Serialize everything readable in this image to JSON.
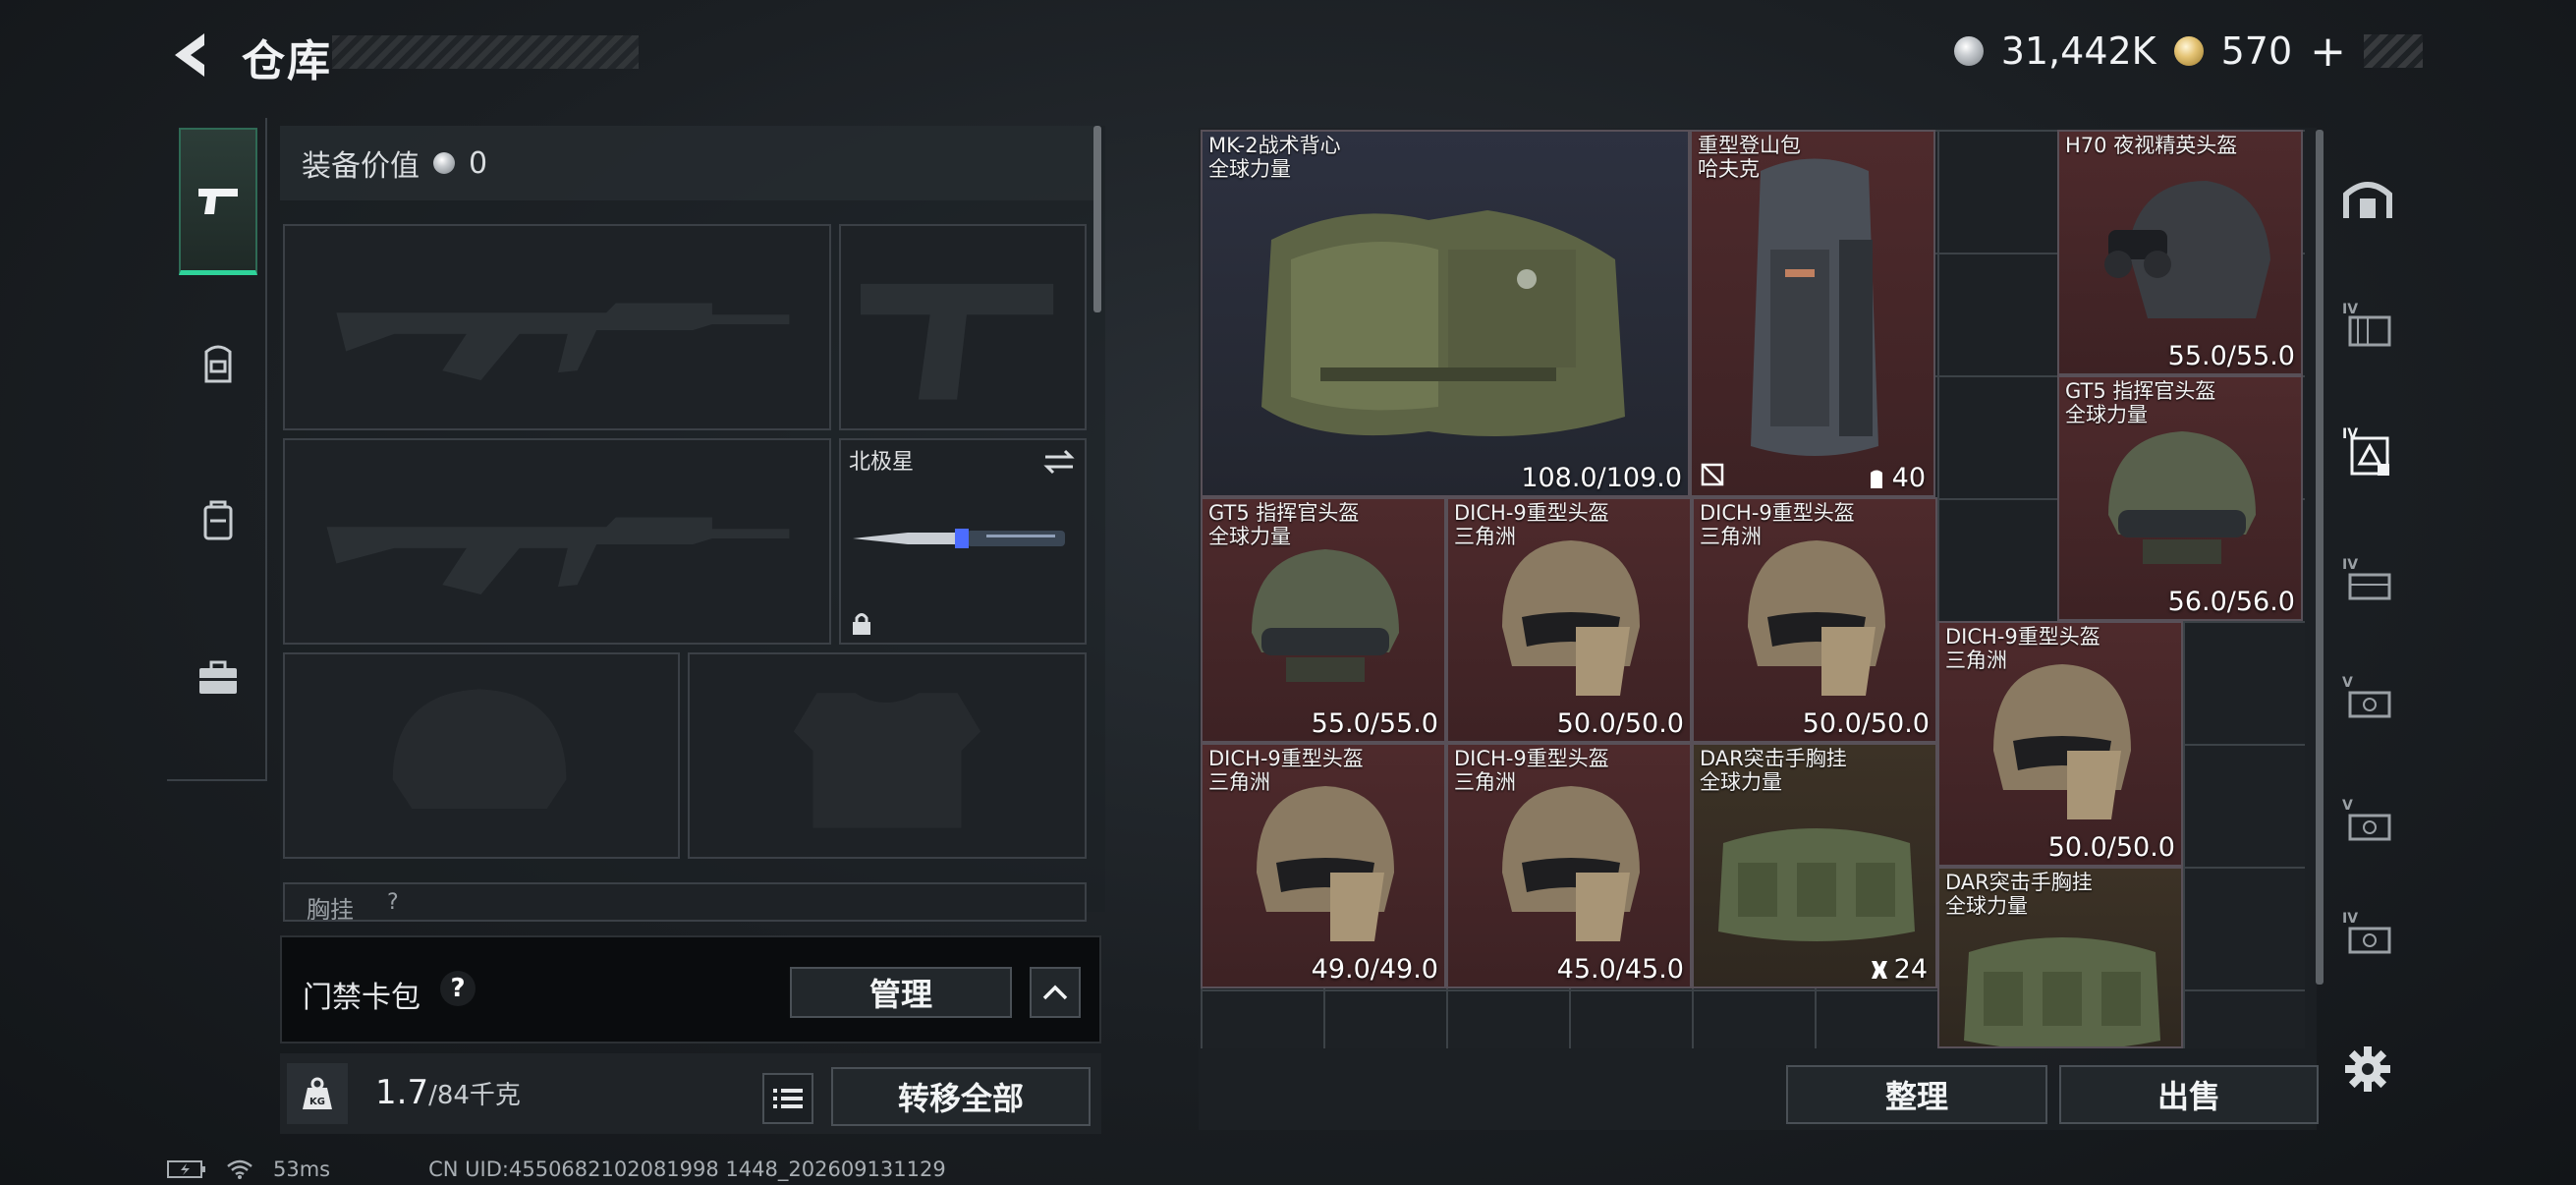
{
  "header": {
    "title": "仓库",
    "currency_silver": "31,442K",
    "currency_gold": "570",
    "gold_plus": "+"
  },
  "left_nav": {
    "items": [
      {
        "name": "weapons",
        "icon": "pistol-icon",
        "active": true
      },
      {
        "name": "armor",
        "icon": "backpack-icon",
        "active": false
      },
      {
        "name": "backpack",
        "icon": "bag-icon",
        "active": false
      },
      {
        "name": "case",
        "icon": "briefcase-icon",
        "active": false
      }
    ]
  },
  "loadout": {
    "value_label": "装备价值",
    "value": "0",
    "melee_name": "北极星",
    "chest_rig_label": "胸挂",
    "chest_rig_hint": "?"
  },
  "card_bar": {
    "label": "门禁卡包",
    "help": "?",
    "manage_label": "管理",
    "expand_icon": "chevron-up-icon"
  },
  "bottom": {
    "weight_current": "1.7",
    "weight_max": "/84千克",
    "weight_icon": "KG",
    "transfer_all_label": "转移全部"
  },
  "inventory": {
    "items": [
      {
        "name": "MK-2战术背心",
        "sub": "全球力量",
        "value": "108.0/109.0",
        "color": "blue",
        "kind": "vest"
      },
      {
        "name": "重型登山包",
        "sub": "哈夫克",
        "extra": "40",
        "color": "red",
        "kind": "backpack"
      },
      {
        "name": "H70 夜视精英头盔",
        "sub": "",
        "value": "55.0/55.0",
        "color": "red",
        "kind": "nv-helmet"
      },
      {
        "name": "GT5 指挥官头盔",
        "sub": "全球力量",
        "value": "56.0/56.0",
        "color": "red",
        "kind": "gt5-helmet"
      },
      {
        "name": "GT5 指挥官头盔",
        "sub": "全球力量",
        "value": "55.0/55.0",
        "color": "red",
        "kind": "gt5-helmet"
      },
      {
        "name": "DICH-9重型头盔",
        "sub": "三角洲",
        "value": "50.0/50.0",
        "color": "red",
        "kind": "dich-helmet"
      },
      {
        "name": "DICH-9重型头盔",
        "sub": "三角洲",
        "value": "50.0/50.0",
        "color": "red",
        "kind": "dich-helmet"
      },
      {
        "name": "DICH-9重型头盔",
        "sub": "三角洲",
        "value": "50.0/50.0",
        "color": "red",
        "kind": "dich-helmet"
      },
      {
        "name": "DICH-9重型头盔",
        "sub": "三角洲",
        "value": "49.0/49.0",
        "color": "red",
        "kind": "dich-helmet"
      },
      {
        "name": "DICH-9重型头盔",
        "sub": "三角洲",
        "value": "45.0/45.0",
        "color": "red",
        "kind": "dich-helmet"
      },
      {
        "name": "DAR突击手胸挂",
        "sub": "全球力量",
        "extra": "24",
        "color": "brown",
        "kind": "chest-rig"
      },
      {
        "name": "DAR突击手胸挂",
        "sub": "全球力量",
        "color": "brown",
        "kind": "chest-rig"
      }
    ],
    "organize_label": "整理",
    "sell_label": "出售"
  },
  "right_nav": {
    "items": [
      "vault-icon",
      "tier-iv-box-icon",
      "tier-iv-bag-icon",
      "tier-iv-case-icon",
      "tier-v-case-icon",
      "tier-v-case-icon",
      "tier-iv-case-icon"
    ],
    "settings_icon": "gear-icon"
  },
  "footer": {
    "ping": "53ms",
    "uid": "CN UID:4550682102081998 1448_202609131129"
  }
}
